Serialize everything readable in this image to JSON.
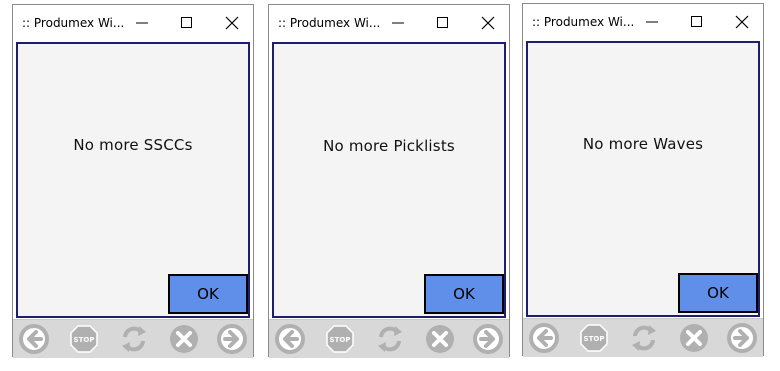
{
  "colors": {
    "content_bg": "#f4f4f4",
    "content_border": "#1e1e6e",
    "ok_button": "#5f8fe8",
    "toolbar_bg": "#d8d8d8",
    "toolbar_icon": "#b0b0b0"
  },
  "toolbar_icons": [
    "back-arrow-icon",
    "stop-icon",
    "refresh-icon",
    "cancel-icon",
    "forward-arrow-icon"
  ],
  "stop_label": "STOP",
  "windows": [
    {
      "title": ":: Produmex Wi...",
      "message": "No more SSCCs",
      "ok_label": "OK"
    },
    {
      "title": ":: Produmex Wi...",
      "message": "No more Picklists",
      "ok_label": "OK"
    },
    {
      "title": ":: Produmex Wi...",
      "message": "No more Waves",
      "ok_label": "OK"
    }
  ]
}
